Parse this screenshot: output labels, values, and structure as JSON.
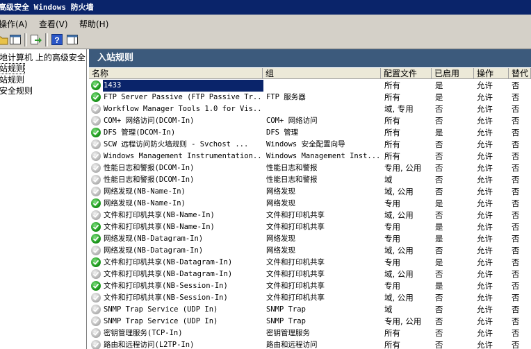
{
  "window": {
    "title": "高级安全 Windows 防火墙"
  },
  "menu": [
    "操作(A)",
    "查看(V)",
    "帮助(H)"
  ],
  "tree": {
    "items": [
      "本地计算机 上的高级安全 Windows 防火墙",
      "入站规则",
      "出站规则",
      "连接安全规则"
    ]
  },
  "pane": {
    "title": "入站规则",
    "columns": [
      "名称",
      "组",
      "配置文件",
      "已启用",
      "操作",
      "替代"
    ]
  },
  "rules": [
    {
      "name": "1433",
      "group": "",
      "profile": "所有",
      "enabled": "是",
      "action": "允许",
      "override": "否",
      "on": true,
      "selected": true
    },
    {
      "name": "FTP Server Passive (FTP Passive Tr...",
      "group": "FTP 服务器",
      "profile": "所有",
      "enabled": "是",
      "action": "允许",
      "override": "否",
      "on": true
    },
    {
      "name": "Workflow Manager Tools 1.0 for Vis...",
      "group": "",
      "profile": "域, 专用",
      "enabled": "否",
      "action": "允许",
      "override": "否",
      "on": false
    },
    {
      "name": "COM+ 网络访问(DCOM-In)",
      "group": "COM+ 网络访问",
      "profile": "所有",
      "enabled": "否",
      "action": "允许",
      "override": "否",
      "on": false
    },
    {
      "name": "DFS 管理(DCOM-In)",
      "group": "DFS 管理",
      "profile": "所有",
      "enabled": "是",
      "action": "允许",
      "override": "否",
      "on": true
    },
    {
      "name": "SCW 远程访问防火墙规则 - Svchost ...",
      "group": "Windows 安全配置向导",
      "profile": "所有",
      "enabled": "否",
      "action": "允许",
      "override": "否",
      "on": false
    },
    {
      "name": "Windows Management Instrumentation...",
      "group": "Windows Management Inst...",
      "profile": "所有",
      "enabled": "否",
      "action": "允许",
      "override": "否",
      "on": false
    },
    {
      "name": "性能日志和警报(DCOM-In)",
      "group": "性能日志和警报",
      "profile": "专用, 公用",
      "enabled": "否",
      "action": "允许",
      "override": "否",
      "on": false
    },
    {
      "name": "性能日志和警报(DCOM-In)",
      "group": "性能日志和警报",
      "profile": "域",
      "enabled": "否",
      "action": "允许",
      "override": "否",
      "on": false
    },
    {
      "name": "网络发现(NB-Name-In)",
      "group": "网络发现",
      "profile": "域, 公用",
      "enabled": "否",
      "action": "允许",
      "override": "否",
      "on": false
    },
    {
      "name": "网络发现(NB-Name-In)",
      "group": "网络发现",
      "profile": "专用",
      "enabled": "是",
      "action": "允许",
      "override": "否",
      "on": true
    },
    {
      "name": "文件和打印机共享(NB-Name-In)",
      "group": "文件和打印机共享",
      "profile": "域, 公用",
      "enabled": "否",
      "action": "允许",
      "override": "否",
      "on": false
    },
    {
      "name": "文件和打印机共享(NB-Name-In)",
      "group": "文件和打印机共享",
      "profile": "专用",
      "enabled": "是",
      "action": "允许",
      "override": "否",
      "on": true
    },
    {
      "name": "网络发现(NB-Datagram-In)",
      "group": "网络发现",
      "profile": "专用",
      "enabled": "是",
      "action": "允许",
      "override": "否",
      "on": true
    },
    {
      "name": "网络发现(NB-Datagram-In)",
      "group": "网络发现",
      "profile": "域, 公用",
      "enabled": "否",
      "action": "允许",
      "override": "否",
      "on": false
    },
    {
      "name": "文件和打印机共享(NB-Datagram-In)",
      "group": "文件和打印机共享",
      "profile": "专用",
      "enabled": "是",
      "action": "允许",
      "override": "否",
      "on": true
    },
    {
      "name": "文件和打印机共享(NB-Datagram-In)",
      "group": "文件和打印机共享",
      "profile": "域, 公用",
      "enabled": "否",
      "action": "允许",
      "override": "否",
      "on": false
    },
    {
      "name": "文件和打印机共享(NB-Session-In)",
      "group": "文件和打印机共享",
      "profile": "专用",
      "enabled": "是",
      "action": "允许",
      "override": "否",
      "on": true
    },
    {
      "name": "文件和打印机共享(NB-Session-In)",
      "group": "文件和打印机共享",
      "profile": "域, 公用",
      "enabled": "否",
      "action": "允许",
      "override": "否",
      "on": false
    },
    {
      "name": "SNMP Trap Service (UDP In)",
      "group": "SNMP Trap",
      "profile": "域",
      "enabled": "否",
      "action": "允许",
      "override": "否",
      "on": false
    },
    {
      "name": "SNMP Trap Service (UDP In)",
      "group": "SNMP Trap",
      "profile": "专用, 公用",
      "enabled": "否",
      "action": "允许",
      "override": "否",
      "on": false
    },
    {
      "name": "密钥管理服务(TCP-In)",
      "group": "密钥管理服务",
      "profile": "所有",
      "enabled": "否",
      "action": "允许",
      "override": "否",
      "on": false
    },
    {
      "name": "路由和远程访问(L2TP-In)",
      "group": "路由和远程访问",
      "profile": "所有",
      "enabled": "否",
      "action": "允许",
      "override": "否",
      "on": false
    }
  ]
}
